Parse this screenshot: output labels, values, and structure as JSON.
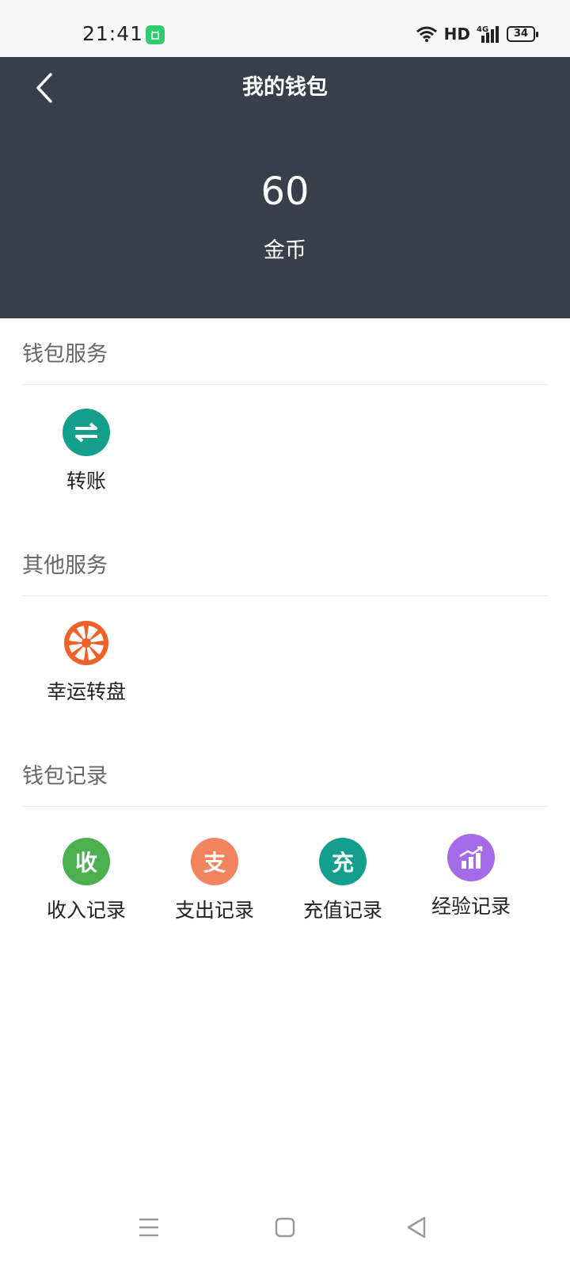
{
  "status_bar": {
    "time": "21:41",
    "network": "HD",
    "signal_label": "4G",
    "battery": "34",
    "icons": [
      "app-notification-icon",
      "wifi-icon",
      "signal-icon",
      "battery-icon"
    ]
  },
  "header": {
    "title": "我的钱包",
    "balance": "60",
    "unit": "金币",
    "background": "#3a3d4a"
  },
  "sections": {
    "wallet_services": {
      "title": "钱包服务",
      "items": [
        {
          "label": "转账",
          "icon": "transfer-icon",
          "color": "#149e8c"
        }
      ]
    },
    "other_services": {
      "title": "其他服务",
      "items": [
        {
          "label": "幸运转盘",
          "icon": "lucky-wheel-icon",
          "color": "#f0612a"
        }
      ]
    },
    "wallet_records": {
      "title": "钱包记录",
      "items": [
        {
          "label": "收入记录",
          "glyph": "收",
          "icon": "income-icon",
          "color": "#4caf50"
        },
        {
          "label": "支出记录",
          "glyph": "支",
          "icon": "expense-icon",
          "color": "#f4845f"
        },
        {
          "label": "充值记录",
          "glyph": "充",
          "icon": "recharge-icon",
          "color": "#149e8c"
        },
        {
          "label": "经验记录",
          "icon": "experience-chart-icon",
          "color": "#a46be8"
        }
      ]
    }
  },
  "nav_bar": {
    "icons": [
      "menu-icon",
      "home-icon",
      "back-icon"
    ]
  }
}
